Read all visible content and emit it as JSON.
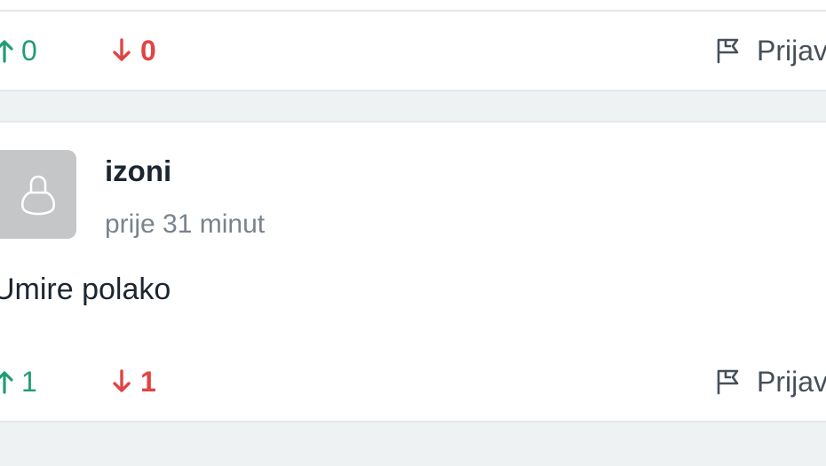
{
  "comments": [
    {
      "upvotes": "0",
      "downvotes": "0",
      "report_label": "Prijavi"
    },
    {
      "username": "izoni",
      "timestamp": "prije 31 minut",
      "text": "Umire polako",
      "upvotes": "1",
      "downvotes": "1",
      "report_label": "Prijavi"
    }
  ],
  "icons": {
    "upvote": "arrow-up-icon",
    "downvote": "arrow-down-icon",
    "report": "flag-icon",
    "avatar": "user-placeholder-icon"
  },
  "colors": {
    "upvote": "#1f9d73",
    "downvote": "#e04444",
    "page_bg": "#eff2f3",
    "avatar_bg": "#c4c6c8"
  }
}
